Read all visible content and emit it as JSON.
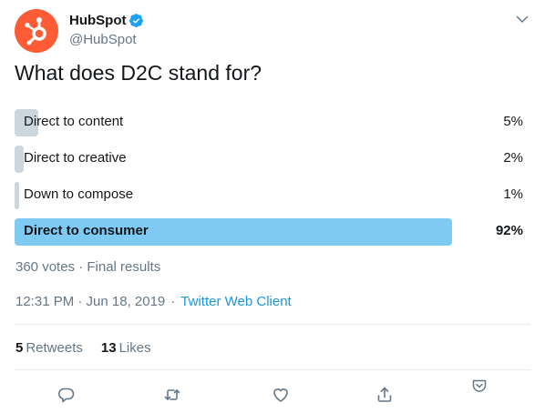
{
  "author": {
    "display_name": "HubSpot",
    "handle": "@HubSpot"
  },
  "icons": {
    "avatar": "hubspot-sprocket-logo",
    "verified": "verified-badge-icon",
    "caret": "chevron-down-icon",
    "reply": "reply-icon",
    "retweet": "retweet-icon",
    "like": "heart-icon",
    "share": "share-icon",
    "pocket": "pocket-icon"
  },
  "colors": {
    "brand": "#ff5c35",
    "accent": "#1b95e0",
    "winner_bar": "#7fcaf3",
    "bar": "#ccd6dd"
  },
  "question": "What does D2C stand for?",
  "poll": {
    "options": [
      {
        "label": "Direct to content",
        "percent_label": "5%",
        "value": 5,
        "winner": false
      },
      {
        "label": "Direct to creative",
        "percent_label": "2%",
        "value": 2,
        "winner": false
      },
      {
        "label": "Down to compose",
        "percent_label": "1%",
        "value": 1,
        "winner": false
      },
      {
        "label": "Direct to consumer",
        "percent_label": "92%",
        "value": 92,
        "winner": true
      }
    ],
    "summary": "360 votes · Final results"
  },
  "meta": {
    "timestamp": "12:31 PM · Jun 18, 2019",
    "separator": "·",
    "source": "Twitter Web Client"
  },
  "stats": {
    "retweets_count": "5",
    "retweets_label": "Retweets",
    "likes_count": "13",
    "likes_label": "Likes"
  }
}
